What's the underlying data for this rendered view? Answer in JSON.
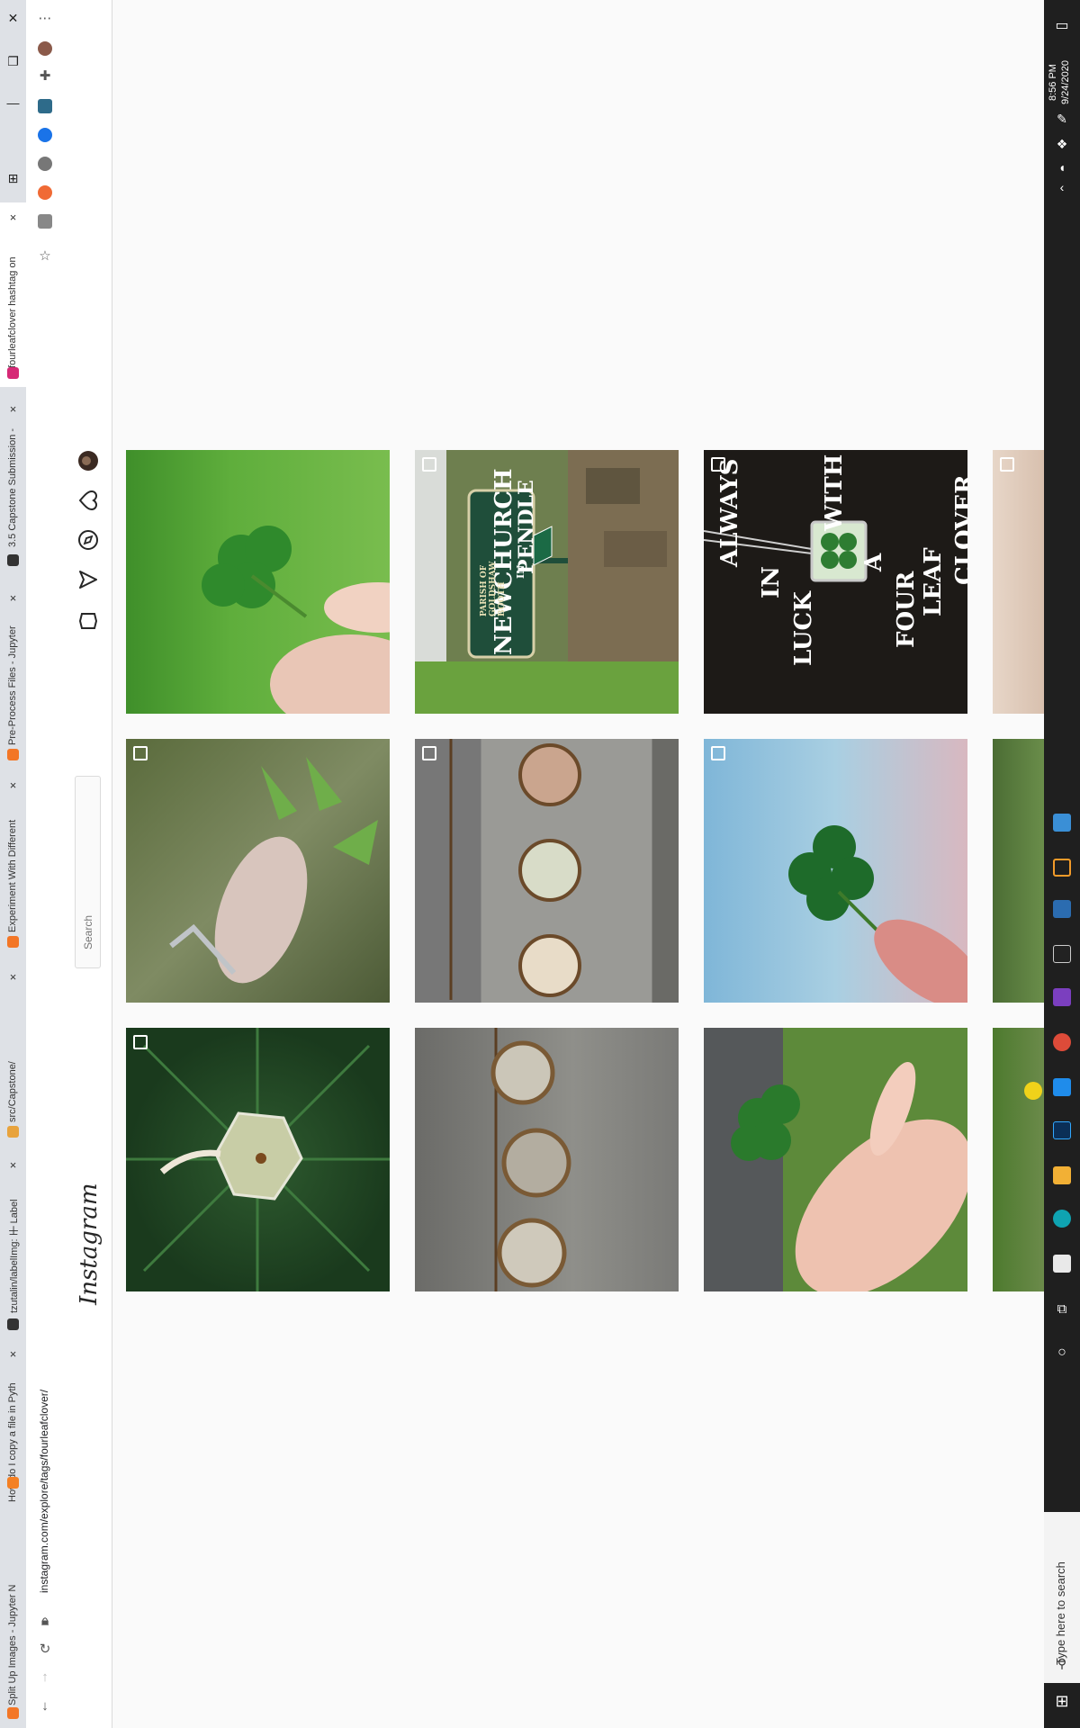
{
  "browser": {
    "tabs": [
      {
        "title": "Split Up Images - Jupyter N",
        "favicon_color": "#f37626"
      },
      {
        "title": "How do I copy a file in Pyth",
        "favicon_color": "#f48024"
      },
      {
        "title": "tzutalin/labelImg: ⼲ Label",
        "favicon_color": "#333333"
      },
      {
        "title": "src/Capstone/",
        "favicon_color": "#e8a33d"
      },
      {
        "title": "Experiment With Different",
        "favicon_color": "#f37626"
      },
      {
        "title": "Pre-Process Files - Jupyter",
        "favicon_color": "#f37626"
      },
      {
        "title": "3.5 Capstone Submission -",
        "favicon_color": "#333333"
      },
      {
        "title": "#fourleafclover hashtag on",
        "favicon_color": "#d62976"
      }
    ],
    "url": "instagram.com/explore/tags/fourleafclover/"
  },
  "page": {
    "logo": "Instagram",
    "search_placeholder": "Search"
  },
  "grid": {
    "tiles": [
      {
        "desc": "hand-holding-clover",
        "multi": false
      },
      {
        "desc": "newchurch-sign",
        "multi": true,
        "sign_text": "NEWCHURCH",
        "sign_sub": "IN",
        "sign_town": "PENDLE",
        "sign_small": "PARISH OF GOLDSHAW BOOTH"
      },
      {
        "desc": "always-in-luck",
        "multi": true,
        "text_lines": [
          "ALWAYS",
          "IN",
          "LUCK",
          "WITH",
          "A",
          "FOUR",
          "LEAF",
          "CLOVER"
        ]
      },
      {
        "desc": "partial-tile-1",
        "multi": true
      },
      {
        "desc": "leaf-keychain",
        "multi": true
      },
      {
        "desc": "pendant-row",
        "multi": true
      },
      {
        "desc": "sky-clover",
        "multi": true
      },
      {
        "desc": "partial-tile-2",
        "multi": false
      },
      {
        "desc": "resin-leaf-keychain",
        "multi": true
      },
      {
        "desc": "bronze-pendants",
        "multi": false
      },
      {
        "desc": "fingers-clover",
        "multi": false
      },
      {
        "desc": "partial-tile-3",
        "multi": false
      }
    ]
  },
  "taskbar": {
    "time": "8:56 PM",
    "date": "9/24/2020",
    "search_placeholder": "Type here to search"
  }
}
